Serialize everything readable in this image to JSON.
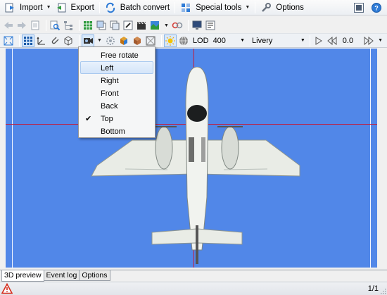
{
  "menubar": {
    "import_label": "Import",
    "export_label": "Export",
    "batch_convert_label": "Batch convert",
    "special_tools_label": "Special tools",
    "options_label": "Options"
  },
  "toolbar3": {
    "lod_label": "LOD",
    "lod_value": "400",
    "livery_value": "Livery",
    "counter_value": "0.0"
  },
  "view_menu": {
    "items": [
      {
        "label": "Free rotate",
        "checked": false,
        "highlighted": false
      },
      {
        "label": "Left",
        "checked": false,
        "highlighted": true
      },
      {
        "label": "Right",
        "checked": false,
        "highlighted": false
      },
      {
        "label": "Front",
        "checked": false,
        "highlighted": false
      },
      {
        "label": "Back",
        "checked": false,
        "highlighted": false
      },
      {
        "label": "Top",
        "checked": true,
        "highlighted": false
      },
      {
        "label": "Bottom",
        "checked": false,
        "highlighted": false
      }
    ]
  },
  "tabs": [
    {
      "label": "3D preview",
      "active": true
    },
    {
      "label": "Event log",
      "active": false
    },
    {
      "label": "Options",
      "active": false
    }
  ],
  "statusbar": {
    "page": "1/1",
    "warning_icon": "warning-icon"
  },
  "colors": {
    "viewport_bg": "#5187e8",
    "crosshair": "#c21a3a",
    "menu_highlight": "#d4e5f9"
  }
}
